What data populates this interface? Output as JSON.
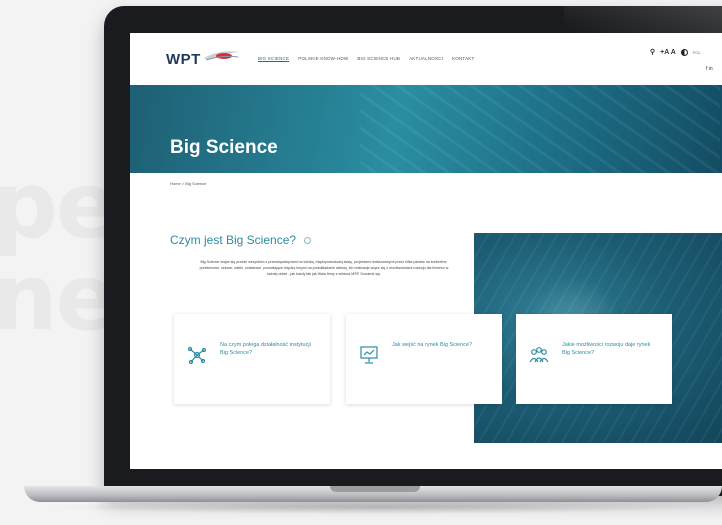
{
  "background_text": [
    "pe",
    "ned."
  ],
  "site": {
    "logo": "WPT",
    "nav": [
      {
        "label": "Big Science",
        "active": true
      },
      {
        "label": "Polskie know-how",
        "active": false
      },
      {
        "label": "Big Science Hub",
        "active": false
      },
      {
        "label": "Aktualności",
        "active": false
      },
      {
        "label": "Kontakt",
        "active": false
      }
    ],
    "tools": {
      "font_size": "+A A",
      "lang": "POL"
    },
    "social": "f in"
  },
  "hero": {
    "title": "Big Science"
  },
  "breadcrumb": "Home > Big Science",
  "section": {
    "title": "Czym jest Big Science?",
    "description": "Big Science wiąże się przede wszystkim z przedsięwzięciami na wielką, międzynarodową skalę, projektami realizowanymi przez kilka państw na konkretne, przełomowe, celowe, wielki, unikatowe, pozwalające między innymi na przedkładanie wiedzy, ich realizacje wiąże się z możliwościami rozwoju dla biznesu w każdej dobie - jak każdy tak jak Wala firmy z sektora MŚP. Dowiedz się."
  },
  "cards": [
    {
      "text": "Na czym polega działalność instytucji Big Science?",
      "icon": "network-icon"
    },
    {
      "text": "Jak wejść na rynek Big Science?",
      "icon": "presentation-icon"
    },
    {
      "text": "Jakie możliwości rozwoju daje rynek Big Science?",
      "icon": "team-icon"
    }
  ],
  "colors": {
    "accent": "#2a8ea2",
    "dark_brand": "#1f3a5a",
    "hero": "#1e5f74"
  }
}
